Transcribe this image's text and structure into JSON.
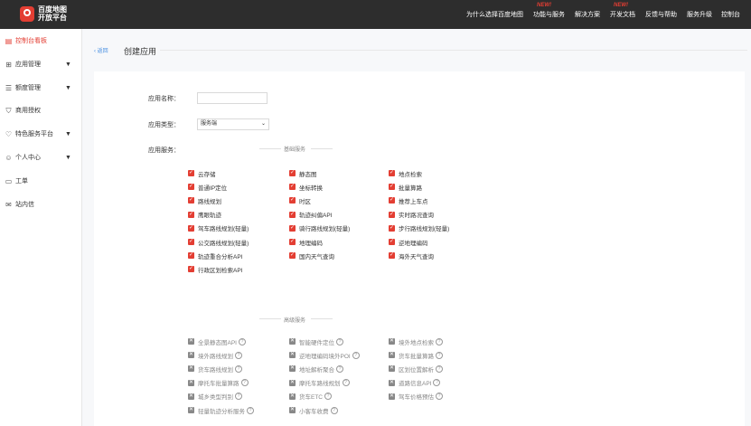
{
  "brand": {
    "line1": "百度地图",
    "line2": "开放平台"
  },
  "nav": [
    {
      "label": "为什么选择百度地图",
      "new": "",
      "caret": ""
    },
    {
      "label": "功能与服务",
      "new": "NEW!",
      "caret": ""
    },
    {
      "label": "解决方案",
      "new": "",
      "caret": ""
    },
    {
      "label": "开发文档",
      "new": "NEW!",
      "caret": ""
    },
    {
      "label": "反馈与帮助",
      "new": "",
      "caret": ""
    },
    {
      "label": "服务升级",
      "new": "",
      "caret": ""
    },
    {
      "label": "控制台",
      "new": "",
      "caret": ""
    }
  ],
  "sidebar": [
    {
      "label": "控制台看板",
      "icon": "dashboard-icon",
      "glyph": "▤",
      "arrow": ""
    },
    {
      "label": "应用管理",
      "icon": "grid-icon",
      "glyph": "⊞",
      "arrow": "▼"
    },
    {
      "label": "额度管理",
      "icon": "sliders-icon",
      "glyph": "☰",
      "arrow": "▼"
    },
    {
      "label": "商用授权",
      "icon": "shield-icon",
      "glyph": "⛉",
      "arrow": ""
    },
    {
      "label": "特色服务平台",
      "icon": "heart-icon",
      "glyph": "♡",
      "arrow": "▼"
    },
    {
      "label": "个人中心",
      "icon": "user-icon",
      "glyph": "☺",
      "arrow": "▼"
    },
    {
      "label": "工单",
      "icon": "document-icon",
      "glyph": "▭",
      "arrow": ""
    },
    {
      "label": "站内信",
      "icon": "mail-icon",
      "glyph": "✉",
      "arrow": ""
    }
  ],
  "header": {
    "back": "‹ 返回",
    "title": "创建应用"
  },
  "form": {
    "name_label": "应用名称：",
    "name_value": "",
    "type_label": "应用类型：",
    "type_value": "服务端",
    "services_label": "应用服务："
  },
  "basic_section": "基础服务",
  "basic_services": [
    [
      "云存储",
      "静态图",
      "地点检索"
    ],
    [
      "普通IP定位",
      "坐标转换",
      "批量算路"
    ],
    [
      "路线规划",
      "时区",
      "推荐上车点"
    ],
    [
      "鹰眼轨迹",
      "轨迹纠偏API",
      "实时路况查询"
    ],
    [
      "驾车路线规划(轻量)",
      "骑行路线规划(轻量)",
      "步行路线规划(轻量)"
    ],
    [
      "公交路线规划(轻量)",
      "地理编码",
      "逆地理编码"
    ],
    [
      "轨迹重合分析API",
      "国内天气查询",
      "海外天气查询"
    ],
    [
      "行政区划检索API",
      "",
      ""
    ]
  ],
  "advanced_section": "高级服务",
  "advanced_services": [
    [
      "全景静态图API",
      "智能硬件定位",
      "境外地点检索"
    ],
    [
      "境外路线规划",
      "逆地理编码境外POI",
      "货车批量算路"
    ],
    [
      "货车路线规划",
      "地址解析聚合",
      "区划位置解析"
    ],
    [
      "摩托车批量算路",
      "摩托车路线规划",
      "道路信息API"
    ],
    [
      "城乡类型判别",
      "货车ETC",
      "驾车价格预估"
    ],
    [
      "轻量轨迹分析服务",
      "小客车收费",
      ""
    ]
  ],
  "colors": {
    "accent": "#e33e33",
    "topbar": "#2d2d2d",
    "link": "#4a90e2"
  }
}
